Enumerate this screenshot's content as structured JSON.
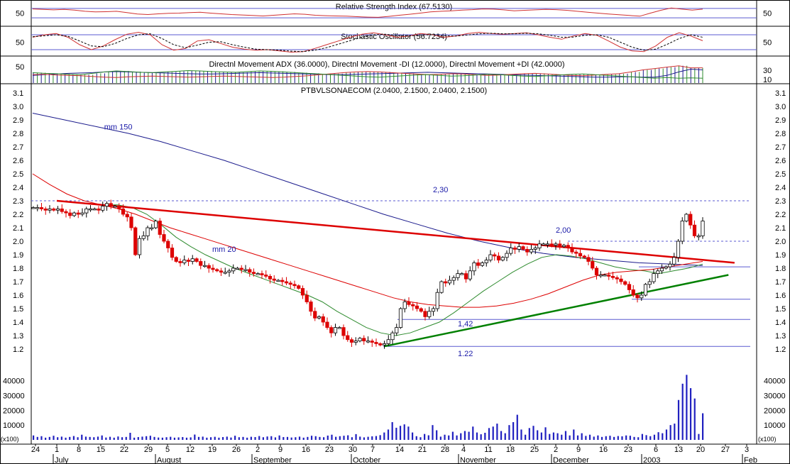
{
  "chart_data": [
    {
      "id": "rsi",
      "type": "line",
      "title": "Relative Strength Index (67.5130)",
      "y_ticks_left": [
        "50"
      ],
      "y_ticks_right": [
        "50"
      ],
      "ylim": [
        0,
        100
      ],
      "reference_lines": [
        70,
        30
      ],
      "series": [
        {
          "values": [
            68,
            66,
            64,
            66,
            63,
            58,
            55,
            56,
            58,
            52,
            46,
            44,
            47,
            49,
            50,
            52,
            54,
            50,
            47,
            44,
            42,
            40,
            38,
            41,
            44,
            47,
            45,
            41,
            39,
            38,
            37,
            35,
            33,
            32,
            36,
            41,
            45,
            50,
            55,
            58,
            60,
            63,
            65,
            68,
            67,
            64,
            60,
            62,
            64,
            66,
            65,
            62,
            58,
            54,
            50,
            46,
            43,
            40,
            37,
            50,
            62,
            72,
            67,
            63,
            67
          ]
        }
      ]
    },
    {
      "id": "stochastic",
      "type": "line",
      "title": "Stochastic Oscillator (56.7234)",
      "y_ticks_left": [
        "50"
      ],
      "y_ticks_right": [
        "50"
      ],
      "ylim": [
        0,
        100
      ],
      "reference_lines": [
        80,
        20
      ],
      "series": [
        {
          "values": [
            70,
            80,
            85,
            70,
            40,
            20,
            35,
            60,
            82,
            90,
            80,
            40,
            18,
            25,
            55,
            60,
            45,
            30,
            22,
            18,
            20,
            15,
            10,
            12,
            25,
            40,
            55,
            70,
            82,
            88,
            80,
            70,
            75,
            85,
            80,
            70,
            75,
            85,
            90,
            85,
            82,
            85,
            88,
            80,
            70,
            62,
            75,
            85,
            78,
            55,
            30,
            15,
            12,
            35,
            70,
            88,
            75,
            56
          ]
        },
        {
          "values": [
            72,
            76,
            80,
            74,
            55,
            35,
            32,
            45,
            65,
            80,
            84,
            65,
            40,
            28,
            38,
            50,
            52,
            40,
            30,
            22,
            20,
            18,
            14,
            12,
            18,
            28,
            42,
            56,
            70,
            80,
            82,
            77,
            75,
            79,
            80,
            76,
            75,
            79,
            84,
            86,
            84,
            84,
            86,
            84,
            78,
            70,
            71,
            78,
            80,
            70,
            50,
            30,
            18,
            22,
            42,
            65,
            80,
            70
          ]
        }
      ]
    },
    {
      "id": "dmi",
      "type": "line",
      "title": "Directnl Movement ADX (36.0000), Directnl Movement -DI (12.0000), Directnl Movement +DI (42.0000)",
      "y_ticks_left": [
        "50"
      ],
      "y_ticks_right": [
        "30",
        "10"
      ],
      "ylim": [
        0,
        70
      ],
      "series": [
        {
          "name": "ADX",
          "values": [
            20,
            22,
            24,
            26,
            27,
            28,
            30,
            31,
            30,
            29,
            28,
            27,
            26,
            25,
            24,
            24,
            25,
            26,
            27,
            28,
            27,
            26,
            25,
            24,
            23,
            22,
            22,
            23,
            24,
            25,
            26,
            27,
            28,
            29,
            28,
            27,
            26,
            25,
            24,
            23,
            22,
            21,
            20,
            19,
            18,
            17,
            16,
            15,
            15,
            16,
            16,
            15,
            15,
            20,
            30,
            38,
            36
          ]
        },
        {
          "name": "-DI",
          "values": [
            28,
            26,
            25,
            23,
            22,
            26,
            30,
            33,
            31,
            29,
            28,
            30,
            32,
            34,
            33,
            31,
            30,
            29,
            31,
            33,
            32,
            30,
            28,
            26,
            24,
            22,
            20,
            18,
            16,
            15,
            17,
            19,
            21,
            22,
            20,
            18,
            19,
            21,
            23,
            22,
            20,
            18,
            17,
            19,
            21,
            23,
            24,
            22,
            20,
            18,
            16,
            14,
            12,
            14,
            12,
            13,
            12
          ]
        },
        {
          "name": "+DI",
          "values": [
            22,
            23,
            21,
            20,
            19,
            17,
            15,
            14,
            16,
            17,
            18,
            17,
            16,
            15,
            16,
            17,
            18,
            17,
            16,
            15,
            14,
            15,
            17,
            19,
            22,
            25,
            28,
            30,
            31,
            30,
            28,
            26,
            24,
            22,
            23,
            25,
            24,
            22,
            20,
            21,
            23,
            25,
            26,
            24,
            22,
            20,
            19,
            21,
            23,
            25,
            30,
            36,
            40,
            44,
            48,
            42,
            42
          ]
        }
      ]
    },
    {
      "id": "price",
      "type": "candlestick",
      "title": "PTBVLSONAECOM (2.0400, 2.1500, 2.0400, 2.1500)",
      "ylim": [
        1.14,
        3.15
      ],
      "y_ticks": [
        "3.1",
        "3.0",
        "2.9",
        "2.8",
        "2.7",
        "2.6",
        "2.5",
        "2.4",
        "2.3",
        "2.2",
        "2.1",
        "2.0",
        "1.9",
        "1.8",
        "1.7",
        "1.6",
        "1.5",
        "1.4",
        "1.3",
        "1.2"
      ],
      "closes": [
        2.25,
        2.25,
        2.24,
        2.23,
        2.24,
        2.23,
        2.24,
        2.22,
        2.21,
        2.19,
        2.21,
        2.2,
        2.21,
        2.24,
        2.24,
        2.24,
        2.23,
        2.26,
        2.28,
        2.26,
        2.26,
        2.24,
        2.2,
        2.18,
        2.1,
        1.9,
        2.02,
        2.04,
        2.1,
        2.1,
        2.15,
        2.05,
        2.0,
        1.95,
        1.88,
        1.85,
        1.84,
        1.86,
        1.85,
        1.87,
        1.85,
        1.82,
        1.82,
        1.8,
        1.79,
        1.78,
        1.77,
        1.77,
        1.78,
        1.8,
        1.8,
        1.79,
        1.79,
        1.77,
        1.76,
        1.76,
        1.75,
        1.74,
        1.72,
        1.71,
        1.71,
        1.7,
        1.69,
        1.68,
        1.67,
        1.65,
        1.6,
        1.55,
        1.48,
        1.43,
        1.44,
        1.4,
        1.36,
        1.32,
        1.36,
        1.36,
        1.3,
        1.27,
        1.25,
        1.26,
        1.28,
        1.26,
        1.26,
        1.25,
        1.24,
        1.23,
        1.24,
        1.27,
        1.32,
        1.36,
        1.5,
        1.55,
        1.53,
        1.52,
        1.5,
        1.48,
        1.44,
        1.48,
        1.5,
        1.62,
        1.7,
        1.69,
        1.71,
        1.73,
        1.76,
        1.76,
        1.72,
        1.78,
        1.84,
        1.82,
        1.84,
        1.86,
        1.9,
        1.89,
        1.86,
        1.88,
        1.91,
        1.95,
        1.94,
        1.96,
        1.94,
        1.92,
        1.94,
        1.95,
        1.98,
        1.98,
        1.98,
        1.97,
        1.98,
        1.96,
        1.97,
        1.95,
        1.92,
        1.91,
        1.89,
        1.88,
        1.85,
        1.8,
        1.75,
        1.75,
        1.75,
        1.74,
        1.73,
        1.72,
        1.7,
        1.68,
        1.64,
        1.6,
        1.58,
        1.6,
        1.68,
        1.7,
        1.76,
        1.78,
        1.8,
        1.81,
        1.83,
        1.88,
        2.0,
        2.15,
        2.2,
        2.12,
        2.04,
        2.04,
        2.15
      ],
      "series": [
        {
          "name": "mm150",
          "values": [
            2.95,
            2.9,
            2.85,
            2.8,
            2.74,
            2.67,
            2.6,
            2.52,
            2.44,
            2.36,
            2.28,
            2.2,
            2.13,
            2.06,
            2.0,
            1.95,
            1.91,
            1.88,
            1.86,
            1.84,
            1.83,
            1.82
          ]
        },
        {
          "name": "mm20",
          "values": [
            2.27,
            2.27,
            2.25,
            2.2,
            2.12,
            2.03,
            1.96,
            1.9,
            1.85,
            1.8,
            1.76,
            1.72,
            1.68,
            1.64,
            1.6,
            1.55,
            1.48,
            1.42,
            1.36,
            1.32,
            1.3,
            1.32,
            1.36,
            1.4,
            1.47,
            1.55,
            1.63,
            1.7,
            1.77,
            1.83,
            1.88,
            1.9,
            1.89,
            1.87,
            1.84,
            1.81,
            1.79,
            1.78,
            1.76,
            1.78,
            1.8,
            1.83
          ]
        },
        {
          "name": "red-ma",
          "values": [
            2.5,
            2.42,
            2.35,
            2.3,
            2.27,
            2.24,
            2.2,
            2.15,
            2.1,
            2.06,
            2.02,
            1.98,
            1.94,
            1.9,
            1.86,
            1.82,
            1.78,
            1.74,
            1.7,
            1.66,
            1.62,
            1.58,
            1.55,
            1.53,
            1.52,
            1.51,
            1.51,
            1.52,
            1.54,
            1.57,
            1.61,
            1.66,
            1.71,
            1.75,
            1.77,
            1.78,
            1.79,
            1.81,
            1.83,
            1.85
          ]
        }
      ],
      "annotations": [
        {
          "text": "mm 150",
          "x": "2002-07-16",
          "y": 2.83
        },
        {
          "text": "mm 20",
          "x": "2002-08-19",
          "y": 1.92
        },
        {
          "text": "2,30",
          "value": 2.3
        },
        {
          "text": "2,00",
          "value": 2.0
        },
        {
          "text": "1,42",
          "value": 1.42
        },
        {
          "text": "1.22",
          "value": 1.22
        }
      ],
      "levels": [
        2.3,
        2.0,
        1.81,
        1.57,
        1.42,
        1.22
      ],
      "trendlines": [
        {
          "color": "#dd0000",
          "from": {
            "date": "2002-07-01",
            "value": 2.3
          },
          "to": {
            "date": "2003-01-30",
            "value": 1.84
          }
        },
        {
          "color": "#008000",
          "from": {
            "date": "2002-10-10",
            "value": 1.22
          },
          "to": {
            "date": "2003-01-28",
            "value": 1.75
          }
        }
      ]
    },
    {
      "id": "volume",
      "type": "bar",
      "y_ticks": [
        "40000",
        "30000",
        "20000",
        "10000"
      ],
      "unit_label": "(x100)",
      "ylim": [
        0,
        48000
      ],
      "values": [
        3000,
        2000,
        2500,
        1500,
        2000,
        2800,
        1800,
        2200,
        1500,
        2000,
        2600,
        1800,
        3500,
        2200,
        2000,
        1800,
        2200,
        3000,
        1600,
        2100,
        1500,
        2300,
        1800,
        2000,
        4800,
        1500,
        1900,
        2200,
        2500,
        2800,
        2000,
        1600,
        1500,
        1800,
        2100,
        1500,
        1700,
        1900,
        1500,
        1700,
        3600,
        2000,
        2200,
        1500,
        1800,
        2100,
        1500,
        1900,
        2200,
        1600,
        2800,
        1800,
        2000,
        1500,
        2100,
        1900,
        2600,
        1800,
        2300,
        2500,
        1700,
        3000,
        1900,
        2000,
        1600,
        1800,
        2200,
        1500,
        2000,
        2800,
        2500,
        2000,
        1800,
        2900,
        3500,
        2100,
        2500,
        2800,
        3100,
        1800,
        3900,
        2200,
        1700,
        2100,
        2400,
        2600,
        3200,
        5000,
        7000,
        12000,
        8200,
        9500,
        10500,
        9000,
        5000,
        2500,
        1800,
        4000,
        3100,
        10000,
        6500,
        2200,
        3500,
        3000,
        5500,
        3000,
        4500,
        6000,
        5500,
        9000,
        5000,
        3800,
        4800,
        8000,
        9000,
        11000,
        6000,
        4500,
        10000,
        12000,
        17000,
        7000,
        3500,
        8000,
        9500,
        6500,
        5000,
        8500,
        4000,
        5000,
        4500,
        3500,
        6000,
        3000,
        7000,
        3000,
        4500,
        2700,
        3500,
        2200,
        3000,
        2000,
        2500,
        2800,
        2000,
        2600,
        2400,
        3000,
        2800,
        2000,
        1800,
        4000,
        3200,
        2500,
        3500,
        5200,
        4500,
        7000,
        10000,
        11000,
        27000,
        38000,
        44000,
        35000,
        28000,
        4000,
        18000
      ]
    }
  ],
  "x_axis": {
    "day_labels": [
      "24",
      "1",
      "8",
      "15",
      "22",
      "29",
      "5",
      "12",
      "19",
      "26",
      "2",
      "9",
      "16",
      "23",
      "30",
      "7",
      "14",
      "21",
      "28",
      "4",
      "11",
      "18",
      "25",
      "2",
      "9",
      "16",
      "23",
      "6",
      "13",
      "20",
      "27",
      "3"
    ],
    "month_labels": [
      "July",
      "August",
      "September",
      "October",
      "November",
      "December",
      "2003",
      "Feb"
    ]
  },
  "colors": {
    "panel_line": "#5a5ad0",
    "up_candle": "#ffffff",
    "down_candle": "#dd0000",
    "volume": "#2020c0",
    "red_trend": "#dd0000",
    "green_trend": "#008000",
    "mm150": "#1a1a8c",
    "mm20": "#2e8b2e",
    "rsi_line": "#d03030",
    "adx": "#1a1a8c",
    "plus_di": "#d03030"
  }
}
